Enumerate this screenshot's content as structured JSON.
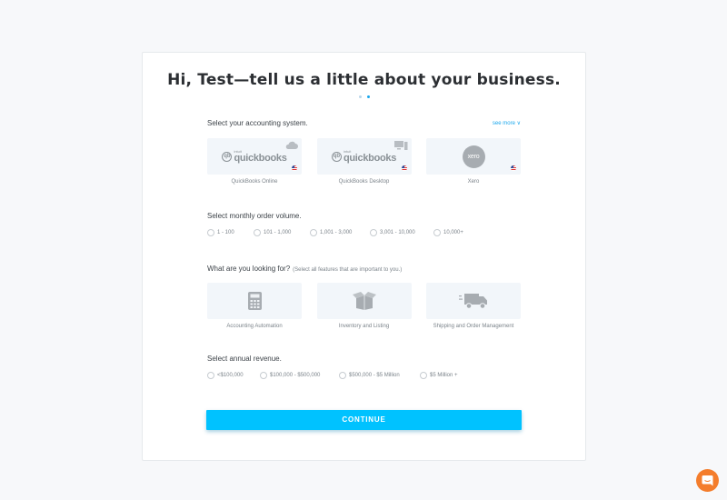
{
  "header": {
    "title": "Hi, Test—tell us a little about your business.",
    "steps": [
      {
        "active": false
      },
      {
        "active": true
      }
    ]
  },
  "accounting": {
    "label": "Select your accounting system.",
    "see_more": "see more ∨",
    "options": [
      {
        "logo_brand": "intuit",
        "logo_name": "quickbooks",
        "caption": "QuickBooks Online",
        "corner_icon": "cloud-icon"
      },
      {
        "logo_brand": "intuit",
        "logo_name": "quickbooks",
        "caption": "QuickBooks Desktop",
        "corner_icon": "desktop-icon"
      },
      {
        "logo_name": "xero",
        "caption": "Xero"
      }
    ]
  },
  "volume": {
    "label": "Select monthly order volume.",
    "options": [
      "1 - 100",
      "101 - 1,000",
      "1,001 - 3,000",
      "3,001 - 10,000",
      "10,000+"
    ]
  },
  "features": {
    "label": "What are you looking for?",
    "hint": "(Select all features that are important to you.)",
    "options": [
      {
        "caption": "Accounting Automation",
        "icon": "calculator-icon"
      },
      {
        "caption": "Inventory and Listing",
        "icon": "box-icon"
      },
      {
        "caption": "Shipping and Order Management",
        "icon": "truck-icon"
      }
    ]
  },
  "revenue": {
    "label": "Select annual revenue.",
    "options": [
      "<$100,000",
      "$100,000 - $500,000",
      "$500,000 - $5 Million",
      "$5 Million +"
    ]
  },
  "continue_label": "CONTINUE",
  "colors": {
    "accent": "#00c2ff",
    "link": "#1aa7ec",
    "tile_bg": "#f2f6fa",
    "chat": "#f47d2c",
    "page_bg": "#f7f8fa"
  }
}
